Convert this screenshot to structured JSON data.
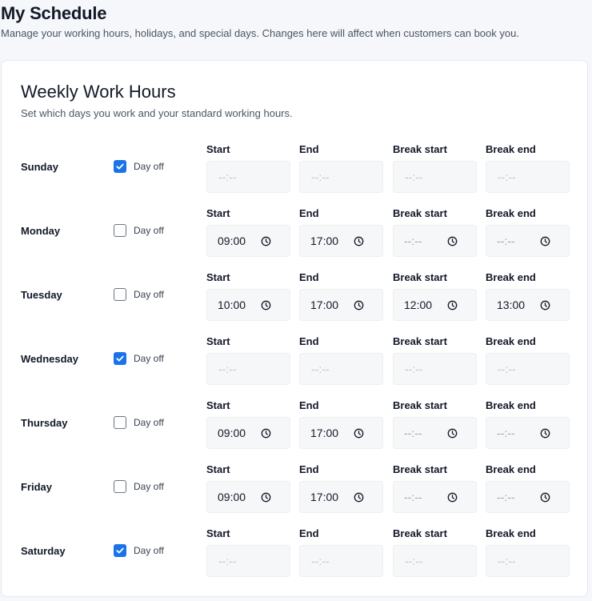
{
  "header": {
    "title": "My Schedule",
    "subtitle": "Manage your working hours, holidays, and special days. Changes here will affect when customers can book you."
  },
  "weekly": {
    "title": "Weekly Work Hours",
    "subtitle": "Set which days you work and your standard working hours.",
    "labels": {
      "start": "Start",
      "end": "End",
      "break_start": "Break start",
      "break_end": "Break end",
      "day_off": "Day off"
    },
    "empty_placeholder": "--:--",
    "accent_color": "#1a73e8",
    "days": [
      {
        "name": "Sunday",
        "day_off": true,
        "start": "",
        "end": "",
        "break_start": "",
        "break_end": ""
      },
      {
        "name": "Monday",
        "day_off": false,
        "start": "09:00",
        "end": "17:00",
        "break_start": "",
        "break_end": ""
      },
      {
        "name": "Tuesday",
        "day_off": false,
        "start": "10:00",
        "end": "17:00",
        "break_start": "12:00",
        "break_end": "13:00"
      },
      {
        "name": "Wednesday",
        "day_off": true,
        "start": "",
        "end": "",
        "break_start": "",
        "break_end": ""
      },
      {
        "name": "Thursday",
        "day_off": false,
        "start": "09:00",
        "end": "17:00",
        "break_start": "",
        "break_end": ""
      },
      {
        "name": "Friday",
        "day_off": false,
        "start": "09:00",
        "end": "17:00",
        "break_start": "",
        "break_end": ""
      },
      {
        "name": "Saturday",
        "day_off": true,
        "start": "",
        "end": "",
        "break_start": "",
        "break_end": ""
      }
    ]
  }
}
